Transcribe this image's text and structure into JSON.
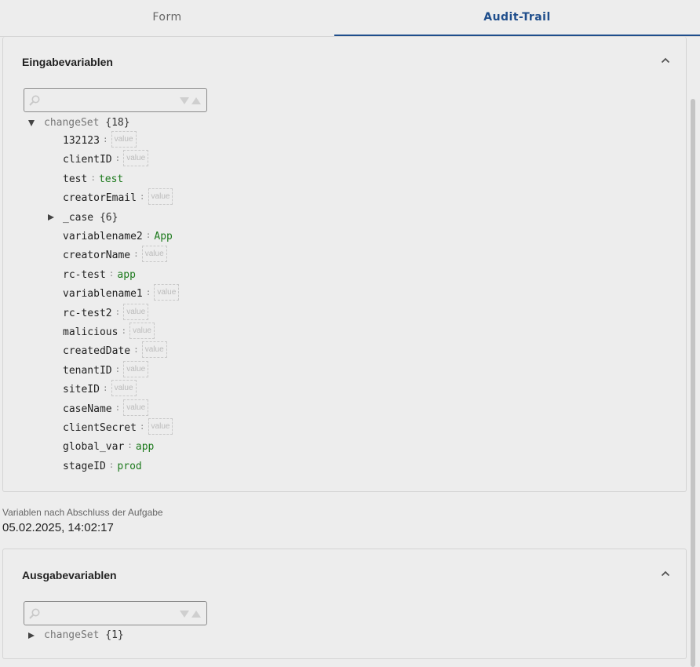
{
  "tabs": {
    "form": "Form",
    "audit_trail": "Audit-Trail",
    "active": "audit_trail"
  },
  "colors": {
    "accent": "#1f4e8c",
    "string_value": "#1d7a1d",
    "background": "#ededed"
  },
  "input_panel": {
    "title": "Eingabevariablen",
    "collapse_icon": "chevron-up-icon",
    "search": {
      "value": "",
      "placeholder": ""
    },
    "tree": {
      "root": {
        "name": "changeSet",
        "count": "{18}",
        "expanded": true
      },
      "entries": [
        {
          "key": "132123",
          "value": "value",
          "empty": true
        },
        {
          "key": "clientID",
          "value": "value",
          "empty": true
        },
        {
          "key": "test",
          "value": "test",
          "empty": false
        },
        {
          "key": "creatorEmail",
          "value": "value",
          "empty": true
        },
        {
          "key": "_case",
          "count": "{6}",
          "group": true
        },
        {
          "key": "variablename2",
          "value": "App",
          "empty": false
        },
        {
          "key": "creatorName",
          "value": "value",
          "empty": true
        },
        {
          "key": "rc-test",
          "value": "app",
          "empty": false
        },
        {
          "key": "variablename1",
          "value": "value",
          "empty": true
        },
        {
          "key": "rc-test2",
          "value": "value",
          "empty": true
        },
        {
          "key": "malicious",
          "value": "value",
          "empty": true
        },
        {
          "key": "createdDate",
          "value": "value",
          "empty": true
        },
        {
          "key": "tenantID",
          "value": "value",
          "empty": true
        },
        {
          "key": "siteID",
          "value": "value",
          "empty": true
        },
        {
          "key": "caseName",
          "value": "value",
          "empty": true
        },
        {
          "key": "clientSecret",
          "value": "value",
          "empty": true
        },
        {
          "key": "global_var",
          "value": "app",
          "empty": false
        },
        {
          "key": "stageID",
          "value": "prod",
          "empty": false
        }
      ]
    }
  },
  "completion": {
    "label": "Variablen nach Abschluss der Aufgabe",
    "timestamp": "05.02.2025, 14:02:17"
  },
  "output_panel": {
    "title": "Ausgabevariablen",
    "collapse_icon": "chevron-up-icon",
    "search": {
      "value": "",
      "placeholder": ""
    },
    "tree": {
      "root": {
        "name": "changeSet",
        "count": "{1}",
        "expanded": false
      }
    }
  }
}
